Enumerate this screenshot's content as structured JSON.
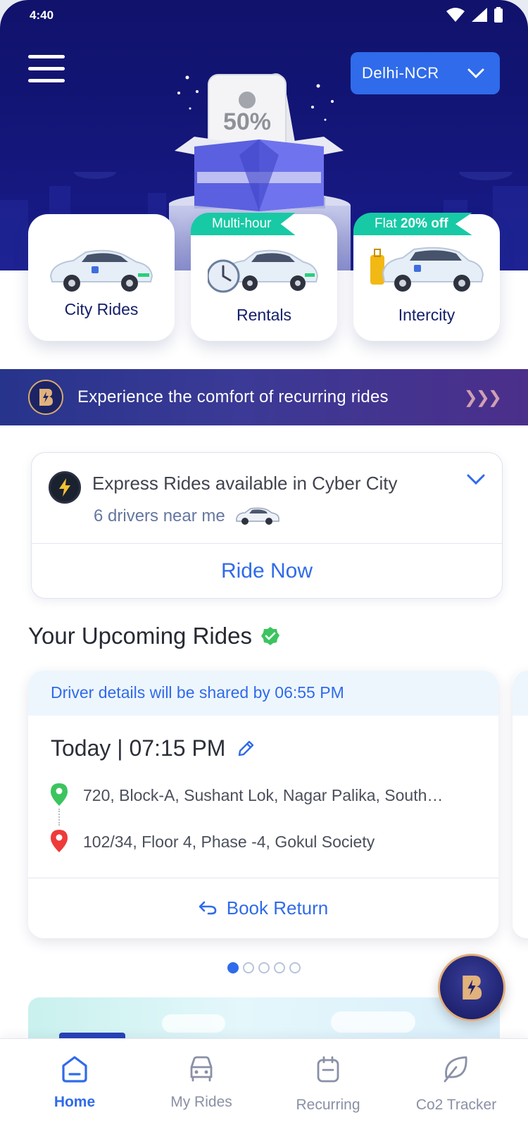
{
  "status_bar": {
    "time": "4:40"
  },
  "header": {
    "city_selector": "Delhi-NCR",
    "reward_badge": "50%"
  },
  "services": [
    {
      "label": "City Rides",
      "tag": ""
    },
    {
      "label": "Rentals",
      "tag": "Multi-hour"
    },
    {
      "label": "Intercity",
      "tag_prefix": "Flat",
      "tag_bold": "20% off"
    }
  ],
  "banner": {
    "text": "Experience the comfort of recurring rides"
  },
  "express": {
    "title": "Express Rides available in Cyber City",
    "subtitle": "6 drivers near me",
    "action": "Ride Now"
  },
  "upcoming": {
    "heading": "Your Upcoming Rides",
    "rides": [
      {
        "notice": "Driver details will be shared by 06:55 PM",
        "when": "Today | 07:15 PM",
        "pickup": "720, Block-A, Sushant Lok, Nagar Palika, South…",
        "drop": "102/34, Floor 4, Phase -4, Gokul Society",
        "action": "Book Return"
      }
    ],
    "pager": {
      "count": 5,
      "active": 1
    }
  },
  "bottom_nav": [
    {
      "label": "Home",
      "active": true
    },
    {
      "label": "My Rides",
      "active": false
    },
    {
      "label": "Recurring",
      "active": false
    },
    {
      "label": "Co2 Tracker",
      "active": false
    }
  ],
  "colors": {
    "brand_blue": "#2f6bea",
    "hero_navy": "#12147a",
    "teal_tag": "#18c9a5",
    "gold": "#d8aa6e"
  }
}
